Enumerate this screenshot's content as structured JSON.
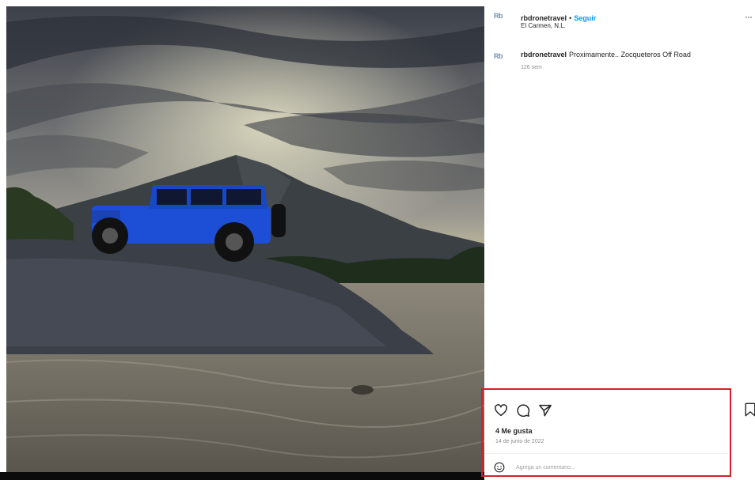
{
  "post": {
    "username": "rbdronetravel",
    "follow_label": "Seguir",
    "separator": "•",
    "location": "El Carmen, N.L.",
    "avatar_text": "Rb",
    "more_label": "···"
  },
  "caption": {
    "username": "rbdronetravel",
    "text": "Proximamente.. Zocqueteros Off Road",
    "time_ago": "126 sem"
  },
  "actions": {
    "icons": [
      "heart-icon",
      "comment-icon",
      "share-icon",
      "bookmark-icon"
    ],
    "likes_label": "4 Me gusta",
    "date_label": "14 de junio de 2022",
    "comment_placeholder": "Agrega un comentario..."
  },
  "colors": {
    "highlight_border": "#d91e2a",
    "follow_blue": "#0095f6",
    "jeep_blue": "#1d4fd6"
  }
}
